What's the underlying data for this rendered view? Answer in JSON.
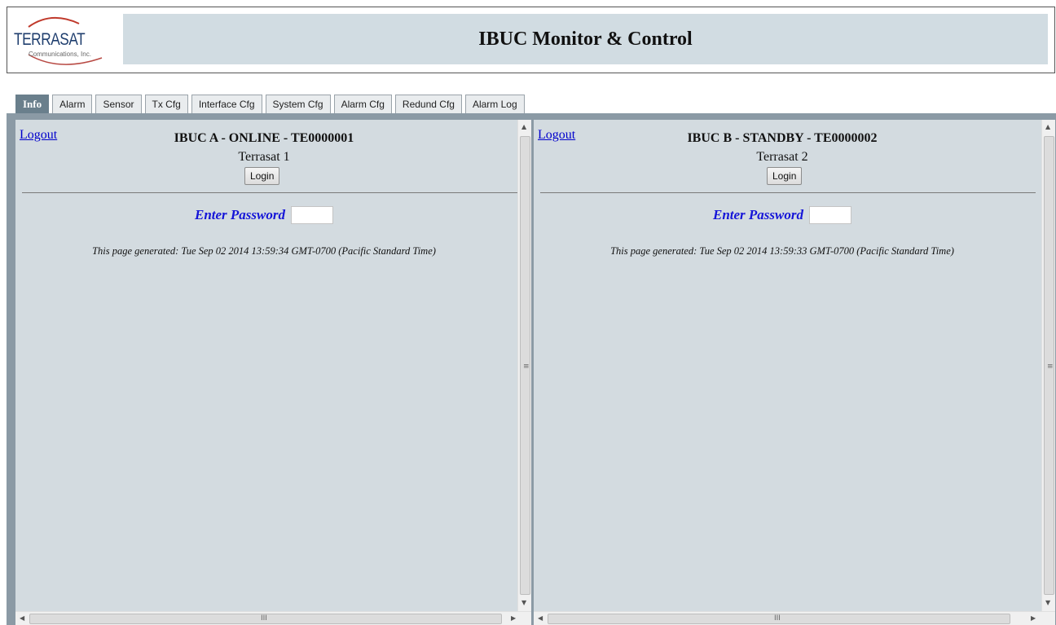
{
  "header": {
    "logo_text": "TERRASAT",
    "logo_subtext": "Communications, Inc.",
    "title": "IBUC Monitor & Control"
  },
  "tabs": [
    {
      "label": "Info",
      "active": true
    },
    {
      "label": "Alarm"
    },
    {
      "label": "Sensor"
    },
    {
      "label": "Tx Cfg"
    },
    {
      "label": "Interface Cfg"
    },
    {
      "label": "System Cfg"
    },
    {
      "label": "Alarm Cfg"
    },
    {
      "label": "Redund Cfg"
    },
    {
      "label": "Alarm Log"
    }
  ],
  "panels": {
    "left": {
      "logout": "Logout",
      "title": "IBUC A - ONLINE - TE0000001",
      "name": "Terrasat 1",
      "login_label": "Login",
      "password_label": "Enter Password",
      "password_value": "",
      "generated": "This page generated: Tue Sep 02 2014 13:59:34 GMT-0700 (Pacific Standard Time)"
    },
    "right": {
      "logout": "Logout",
      "title": "IBUC B - STANDBY - TE0000002",
      "name": "Terrasat 2",
      "login_label": "Login",
      "password_label": "Enter Password",
      "password_value": "",
      "generated": "This page generated: Tue Sep 02 2014 13:59:33 GMT-0700 (Pacific Standard Time)"
    }
  },
  "scrollbar": {
    "grip": "≡",
    "hgrip": "III",
    "up": "▲",
    "down": "▼",
    "left": "◀",
    "right": "▶"
  },
  "colors": {
    "title_bar": "#d1dce2",
    "panel_bg": "#d3dbe0",
    "frame_bg": "#8b9aa5",
    "active_tab": "#6a7f8c",
    "link": "#0000cc",
    "password_label": "#1515d8"
  }
}
